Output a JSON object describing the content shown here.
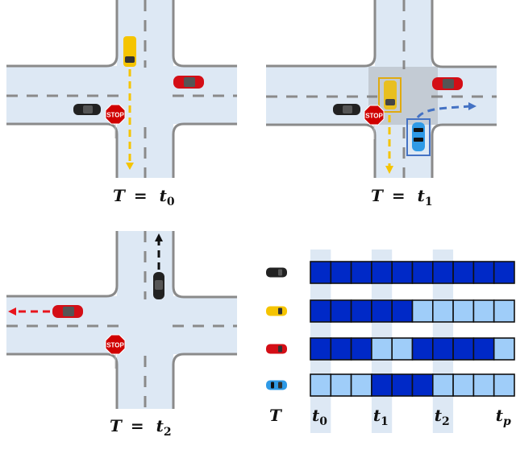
{
  "figure": {
    "description": "Intersection scenes at three timesteps and a per-agent timestep grid",
    "colors": {
      "road": "#dde8f4",
      "curb": "#8a8a8a",
      "lane_dash": "#8a8a8a",
      "active_cell": "#0029c7",
      "inactive_cell": "#9fcdf9",
      "column_highlight": "#dde8f4",
      "focus_box": "#808080",
      "yellow": "#f5c400",
      "red": "#d40e16",
      "black": "#222222",
      "blue": "#2f9ae6",
      "blue_path": "#4472c4",
      "stop_sign": "#d00000"
    }
  },
  "panels": [
    {
      "id": "t0",
      "label": {
        "T": "T",
        "eq": "=",
        "t": "t",
        "sub": "0"
      },
      "vehicles": [
        "yellow-car",
        "red-car",
        "black-car"
      ],
      "paths": [
        "yellow-dashed-down"
      ],
      "sign": "STOP"
    },
    {
      "id": "t1",
      "label": {
        "T": "T",
        "eq": "=",
        "t": "t",
        "sub": "1"
      },
      "vehicles": [
        "yellow-car",
        "red-car",
        "black-car",
        "blue-car"
      ],
      "paths": [
        "yellow-dashed-down",
        "blue-dashed-right-turn"
      ],
      "highlight_boxes": [
        "yellow-car",
        "blue-car"
      ],
      "sign": "STOP"
    },
    {
      "id": "t2",
      "label": {
        "T": "T",
        "eq": "=",
        "t": "t",
        "sub": "2"
      },
      "vehicles": [
        "red-car",
        "black-car"
      ],
      "paths": [
        "red-dashed-left",
        "black-dashed-up"
      ],
      "sign": "STOP"
    }
  ],
  "grid": {
    "row_axis_label": "T",
    "columns": 10,
    "column_labels": [
      {
        "t": "t",
        "sub": "0",
        "col": 0
      },
      {
        "t": "t",
        "sub": "1",
        "col": 3
      },
      {
        "t": "t",
        "sub": "2",
        "col": 6
      },
      {
        "t": "t",
        "sub": "p",
        "col": 9
      }
    ],
    "highlight_columns": [
      0,
      3,
      6
    ],
    "rows": [
      {
        "agent": "black-car",
        "states": [
          1,
          1,
          1,
          1,
          1,
          1,
          1,
          1,
          1,
          1
        ]
      },
      {
        "agent": "yellow-car",
        "states": [
          1,
          1,
          1,
          1,
          1,
          0,
          0,
          0,
          0,
          0
        ]
      },
      {
        "agent": "red-car",
        "states": [
          1,
          1,
          1,
          0,
          0,
          1,
          1,
          1,
          1,
          0
        ]
      },
      {
        "agent": "blue-car",
        "states": [
          0,
          0,
          0,
          1,
          1,
          1,
          0,
          0,
          0,
          0
        ]
      }
    ]
  }
}
